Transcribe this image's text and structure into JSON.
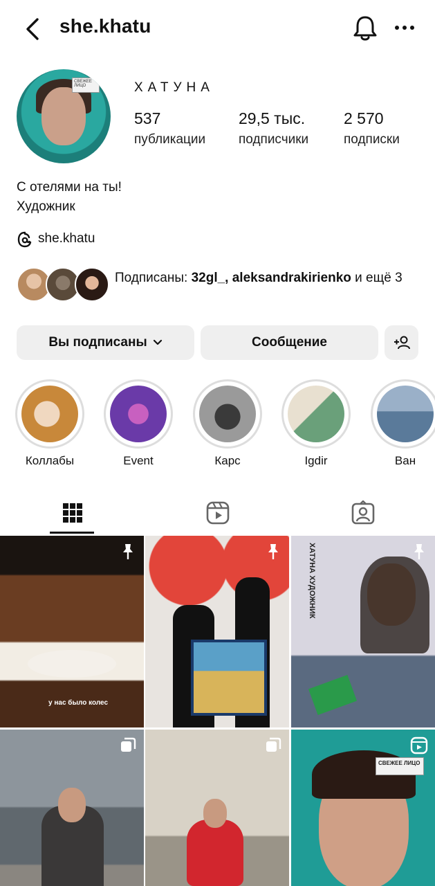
{
  "header": {
    "username": "she.khatu"
  },
  "profile": {
    "full_name": "ХАТУНА",
    "stats": [
      {
        "value": "537",
        "label": "публикации"
      },
      {
        "value": "29,5 тыс.",
        "label": "подписчики"
      },
      {
        "value": "2 570",
        "label": "подписки"
      }
    ],
    "avatar_tag": "СВЕЖЕЕ ЛИЦО",
    "bio": [
      "С отелями на ты!",
      "Художник"
    ],
    "threads_handle": "she.khatu"
  },
  "followed_by": {
    "prefix": "Подписаны: ",
    "names": "32gl_, aleksandrakirienko",
    "suffix": " и ещё 3"
  },
  "actions": {
    "following_label": "Вы подписаны",
    "message_label": "Сообщение"
  },
  "highlights": [
    {
      "label": "Коллабы",
      "color": "#c8883a"
    },
    {
      "label": "Event",
      "color": "#6a3aa8"
    },
    {
      "label": "Карс",
      "color": "#7a7a7a"
    },
    {
      "label": "Igdir",
      "color": "#6aa07a"
    },
    {
      "label": "Ван",
      "color": "#5a7a9a"
    }
  ],
  "grid": [
    {
      "caption": "у нас было колес",
      "color": "#6a3d22"
    },
    {
      "caption": "",
      "color": "#e8e4e0"
    },
    {
      "caption": "ХАТУНА ХУДОЖНИК",
      "color": "#d8d6e0"
    },
    {
      "caption": "",
      "color": "#7d8790"
    },
    {
      "caption": "",
      "color": "#c9c2b4"
    },
    {
      "caption": "СВЕЖЕЕ ЛИЦО",
      "color": "#1f9c96"
    }
  ],
  "colors": {
    "accent": "#111111",
    "button_bg": "#efefef"
  }
}
